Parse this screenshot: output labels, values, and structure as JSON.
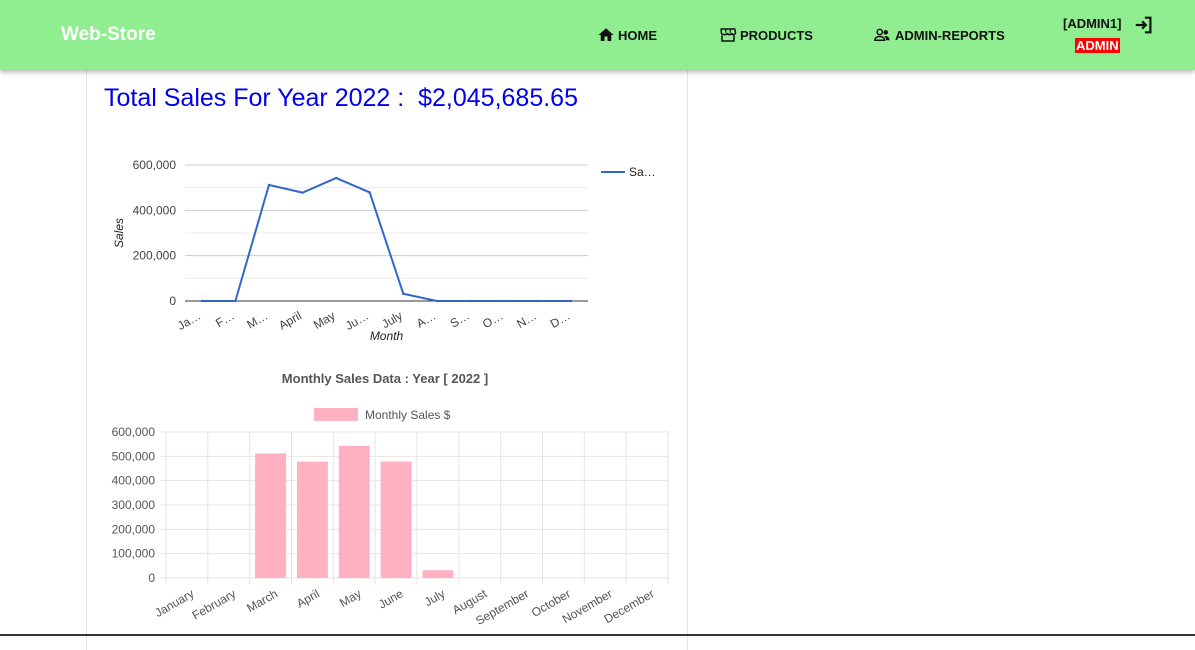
{
  "navbar": {
    "brand": "Web-Store",
    "home_label": "HOME",
    "products_label": "PRODUCTS",
    "reports_label": "ADMIN-REPORTS",
    "user_name": "[ADMIN1]",
    "user_role": "ADMIN",
    "bg_color": "#90ee90",
    "icons": [
      "home-icon",
      "store-icon",
      "users-icon",
      "logout-icon"
    ]
  },
  "total": {
    "label": "Total Sales For Year 2022 : ",
    "value": "$2,045,685.65",
    "color": "#0000ee"
  },
  "chart_data": [
    {
      "type": "line",
      "categories": [
        "Ja…",
        "F…",
        "M…",
        "April",
        "May",
        "Ju…",
        "July",
        "A…",
        "S…",
        "O…",
        "N…",
        "D…"
      ],
      "series": [
        {
          "name": "Sa…",
          "values": [
            0,
            0,
            512000,
            478000,
            543000,
            479000,
            32000,
            0,
            0,
            0,
            0,
            0
          ]
        }
      ],
      "xlabel": "Month",
      "ylabel": "Sales",
      "ylim": [
        0,
        600000
      ],
      "yticks": [
        "0",
        "200,000",
        "400,000",
        "600,000"
      ],
      "grid": true,
      "legend": "right",
      "color": "#3366cc"
    },
    {
      "type": "bar",
      "title": "Monthly Sales Data  : Year [ 2022 ]",
      "categories": [
        "January",
        "February",
        "March",
        "April",
        "May",
        "June",
        "July",
        "August",
        "September",
        "October",
        "November",
        "December"
      ],
      "series": [
        {
          "name": "Monthly Sales $",
          "values": [
            0,
            0,
            512000,
            478000,
            543000,
            479000,
            32000,
            0,
            0,
            0,
            0,
            0
          ]
        }
      ],
      "ylim": [
        0,
        600000
      ],
      "yticks": [
        "0",
        "100,000",
        "200,000",
        "300,000",
        "400,000",
        "500,000",
        "600,000"
      ],
      "grid": true,
      "legend": "top",
      "color": "#ffb1c1"
    }
  ]
}
